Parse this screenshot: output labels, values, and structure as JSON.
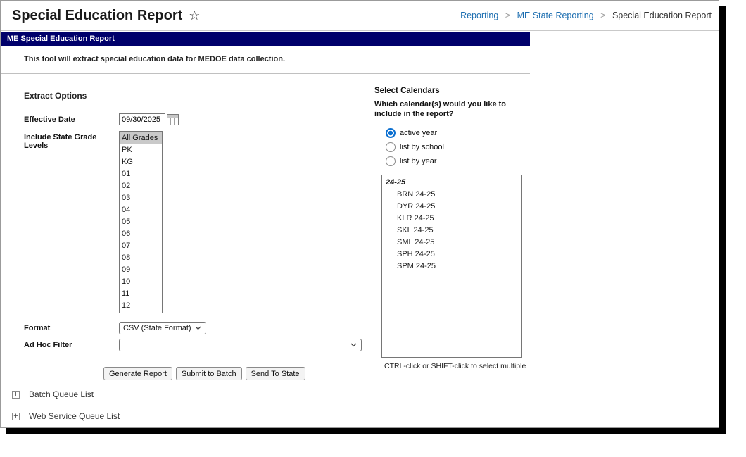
{
  "header": {
    "title": "Special Education Report",
    "breadcrumb": {
      "items": [
        {
          "label": "Reporting"
        },
        {
          "label": "ME State Reporting"
        },
        {
          "label": "Special Education Report"
        }
      ]
    }
  },
  "banner": {
    "title": "ME Special Education Report"
  },
  "description": "This tool will extract special education data for MEDOE data collection.",
  "extract": {
    "section_title": "Extract Options",
    "effective_date_label": "Effective Date",
    "effective_date_value": "09/30/2025",
    "grades_label": "Include State Grade Levels",
    "grades": {
      "selected": "All Grades",
      "options": [
        "All Grades",
        "PK",
        "KG",
        "01",
        "02",
        "03",
        "04",
        "05",
        "06",
        "07",
        "08",
        "09",
        "10",
        "11",
        "12"
      ]
    },
    "format_label": "Format",
    "format_value": "CSV (State Format)",
    "adhoc_label": "Ad Hoc Filter",
    "adhoc_value": "",
    "buttons": {
      "generate": "Generate Report",
      "batch": "Submit to Batch",
      "state": "Send To State"
    }
  },
  "calendars": {
    "title": "Select Calendars",
    "question": "Which calendar(s) would you like to include in the report?",
    "radios": [
      {
        "label": "active year",
        "selected": true
      },
      {
        "label": "list by school",
        "selected": false
      },
      {
        "label": "list by year",
        "selected": false
      }
    ],
    "year_group": "24-25",
    "items": [
      "BRN 24-25",
      "DYR 24-25",
      "KLR 24-25",
      "SKL 24-25",
      "SML 24-25",
      "SPH 24-25",
      "SPM 24-25"
    ],
    "hint": "CTRL-click or SHIFT-click to select multiple"
  },
  "queues": {
    "batch": "Batch Queue List",
    "web_service": "Web Service Queue List"
  },
  "icons": {
    "star": "☆",
    "expand": "+",
    "separator": ">"
  },
  "colors": {
    "banner_bg": "#00006b",
    "link_blue": "#1b6db0",
    "radio_accent": "#0b6fd0",
    "selected_option_bg": "#c9c9c9"
  }
}
